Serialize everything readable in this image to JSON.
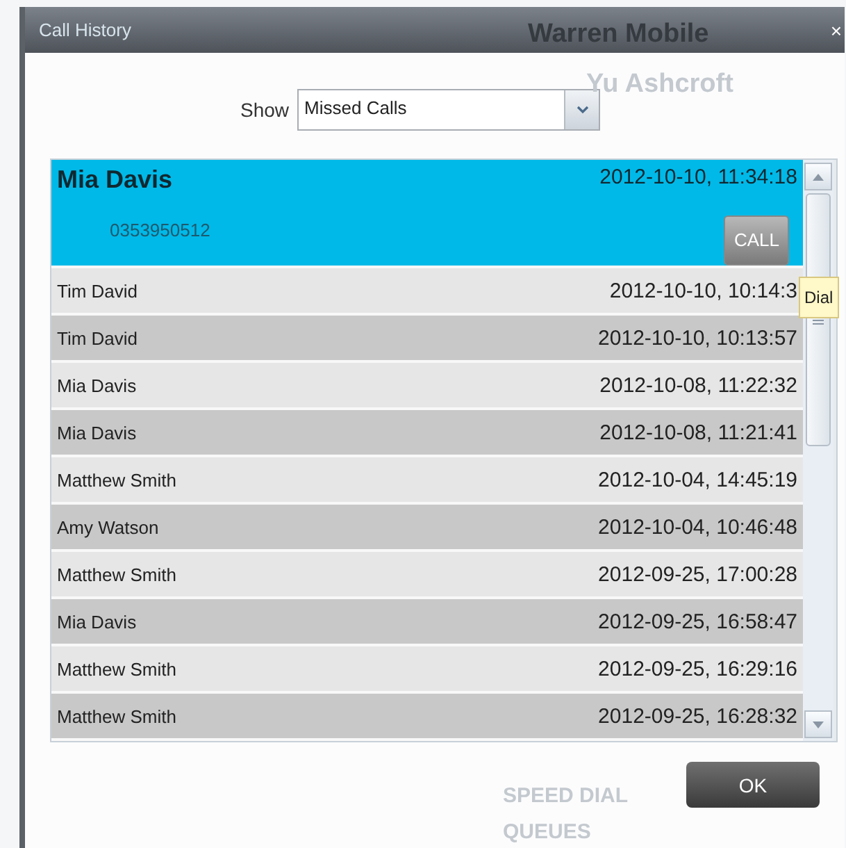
{
  "window": {
    "title": "Call History",
    "close": "×"
  },
  "background": {
    "contacts": [
      "Warren Mobile",
      "Yu Ashcroft"
    ],
    "sections": [
      "SPEED DIAL",
      "QUEUES"
    ]
  },
  "filter": {
    "label": "Show",
    "value": "Missed Calls"
  },
  "calls": [
    {
      "name": "Mia Davis",
      "time": "2012-10-10, 11:34:18",
      "number": "0353950512",
      "action": "CALL",
      "selected": true
    },
    {
      "name": "Tim David",
      "time": "2012-10-10, 10:14:3",
      "selected": false
    },
    {
      "name": "Tim David",
      "time": "2012-10-10, 10:13:57",
      "selected": false
    },
    {
      "name": "Mia Davis",
      "time": "2012-10-08, 11:22:32",
      "selected": false
    },
    {
      "name": "Mia Davis",
      "time": "2012-10-08, 11:21:41",
      "selected": false
    },
    {
      "name": "Matthew Smith",
      "time": "2012-10-04, 14:45:19",
      "selected": false
    },
    {
      "name": "Amy Watson",
      "time": "2012-10-04, 10:46:48",
      "selected": false
    },
    {
      "name": "Matthew Smith",
      "time": "2012-09-25, 17:00:28",
      "selected": false
    },
    {
      "name": "Mia Davis",
      "time": "2012-09-25, 16:58:47",
      "selected": false
    },
    {
      "name": "Matthew Smith",
      "time": "2012-09-25, 16:29:16",
      "selected": false
    },
    {
      "name": "Matthew Smith",
      "time": "2012-09-25, 16:28:32",
      "selected": false
    }
  ],
  "tooltip": "Dial",
  "ok": "OK"
}
